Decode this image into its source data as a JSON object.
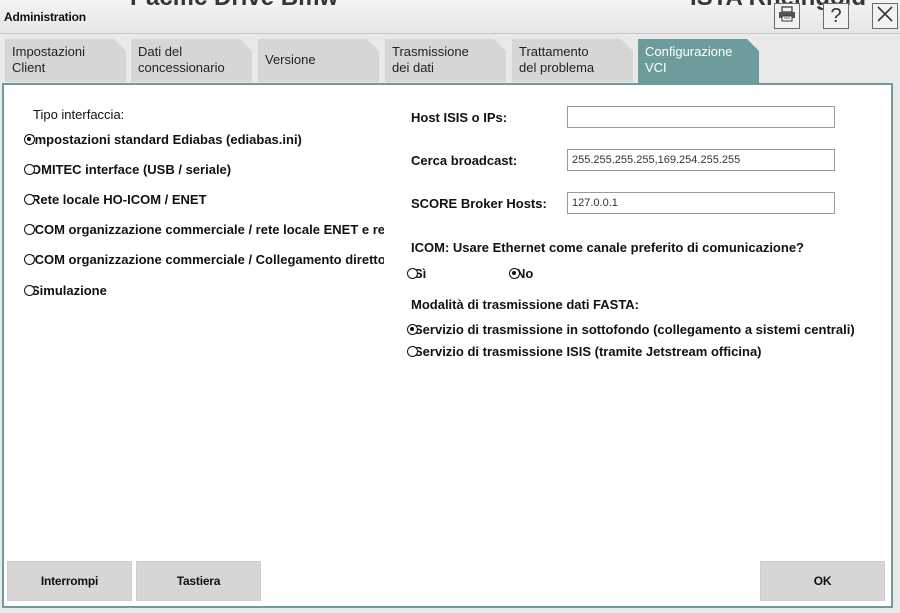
{
  "window": {
    "title": "Administration",
    "bg_fragment_left": "Pacific Drive Bmw",
    "bg_fragment_right": "ISTA Rheingold",
    "icons": [
      "printer-icon",
      "help-icon",
      "close-icon"
    ],
    "help_label": "?"
  },
  "tabs": [
    {
      "line1": "Impostazioni",
      "line2": "Client"
    },
    {
      "line1": "Dati del",
      "line2": "concessionario"
    },
    {
      "line1": "Versione",
      "line2": ""
    },
    {
      "line1": "Trasmissione",
      "line2": "dei dati"
    },
    {
      "line1": "Trattamento",
      "line2": "del problema"
    },
    {
      "line1": "Configurazione",
      "line2": "VCI",
      "active": true
    }
  ],
  "interface": {
    "heading": "Tipo interfaccia:",
    "options": [
      {
        "label": "Impostazioni standard Ediabas (ediabas.ini)",
        "selected": true
      },
      {
        "label": "OMITEC interface (USB / seriale)",
        "selected": false
      },
      {
        "label": "Rete locale HO-ICOM / ENET",
        "selected": false
      },
      {
        "label": "ICOM organizzazione commerciale / rete locale ENET e rete",
        "selected": false
      },
      {
        "label": "ICOM organizzazione commerciale / Collegamento diretto ENET",
        "selected": false
      },
      {
        "label": "Simulazione",
        "selected": false
      }
    ]
  },
  "network": {
    "isis_label": "Host ISIS o IPs:",
    "isis_value": "",
    "broadcast_label": "Cerca broadcast:",
    "broadcast_value": "255.255.255.255,169.254.255.255",
    "score_label": "SCORE Broker Hosts:",
    "score_value": "127.0.0.1"
  },
  "ethernet": {
    "question": "ICOM: Usare Ethernet come canale preferito di comunicazione?",
    "yes_label": "Sì",
    "no_label": "No",
    "selected": "No"
  },
  "fasta": {
    "heading": "Modalità di trasmissione dati FASTA:",
    "options": [
      {
        "label": "Servizio di trasmissione in sottofondo (collegamento a sistemi centrali)",
        "selected": true
      },
      {
        "label": "Servizio di trasmissione ISIS (tramite Jetstream officina)",
        "selected": false
      }
    ]
  },
  "buttons": {
    "cancel": "Interrompi",
    "keyboard": "Tastiera",
    "ok": "OK"
  },
  "colors": {
    "accent": "#6c9c9c",
    "tab_inactive": "#d6d6d6",
    "button": "#d6d6d6"
  }
}
